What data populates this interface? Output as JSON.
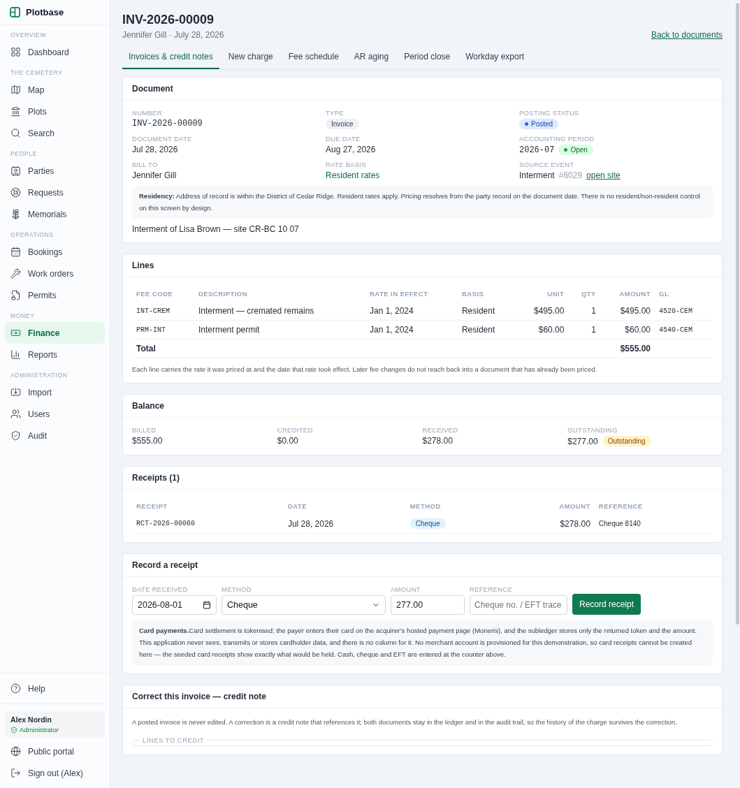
{
  "brand": {
    "name": "Plotbase"
  },
  "sidebar": {
    "sections": [
      {
        "heading": "OVERVIEW",
        "items": [
          {
            "label": "Dashboard",
            "selected": false
          }
        ]
      },
      {
        "heading": "THE CEMETERY",
        "items": [
          {
            "label": "Map",
            "selected": false
          },
          {
            "label": "Plots",
            "selected": false
          },
          {
            "label": "Search",
            "selected": false
          }
        ]
      },
      {
        "heading": "PEOPLE",
        "items": [
          {
            "label": "Parties",
            "selected": false
          },
          {
            "label": "Requests",
            "selected": false
          },
          {
            "label": "Memorials",
            "selected": false
          }
        ]
      },
      {
        "heading": "OPERATIONS",
        "items": [
          {
            "label": "Bookings",
            "selected": false
          },
          {
            "label": "Work orders",
            "selected": false
          },
          {
            "label": "Permits",
            "selected": false
          }
        ]
      },
      {
        "heading": "MONEY",
        "items": [
          {
            "label": "Finance",
            "selected": true
          },
          {
            "label": "Reports",
            "selected": false
          }
        ]
      },
      {
        "heading": "ADMINISTRATION",
        "items": [
          {
            "label": "Import",
            "selected": false
          },
          {
            "label": "Users",
            "selected": false
          },
          {
            "label": "Audit",
            "selected": false
          }
        ]
      }
    ],
    "help": "Help",
    "user": {
      "name": "Alex Nordin",
      "role": "Administrator"
    },
    "links": [
      "Public portal",
      "Sign out (Alex)"
    ]
  },
  "header": {
    "title": "INV-2026-00009",
    "subtitle": "Jennifer Gill · July 28, 2026",
    "back_link": "Back to documents"
  },
  "tabs": [
    {
      "label": "Invoices & credit notes",
      "selected": true
    },
    {
      "label": "New charge",
      "selected": false
    },
    {
      "label": "Fee schedule",
      "selected": false
    },
    {
      "label": "AR aging",
      "selected": false
    },
    {
      "label": "Period close",
      "selected": false
    },
    {
      "label": "Workday export",
      "selected": false
    }
  ],
  "document": {
    "title": "Document",
    "fields": [
      {
        "kind": "mono",
        "label": "NUMBER",
        "value": "INV-2026-00009"
      },
      {
        "kind": "pill",
        "label": "TYPE",
        "value": "Invoice"
      },
      {
        "kind": "status",
        "label": "POSTING STATUS",
        "value": "Posted",
        "color": "#2563eb"
      },
      {
        "kind": "text",
        "label": "DOCUMENT DATE",
        "value": "Jul 28, 2026"
      },
      {
        "kind": "text",
        "label": "DUE DATE",
        "value": "Aug 27, 2026"
      },
      {
        "kind": "period",
        "label": "ACCOUNTING PERIOD",
        "value": "2026-07",
        "badge": "Open",
        "color": "#16a34a"
      },
      {
        "kind": "text",
        "label": "BILL TO",
        "value": "Jennifer Gill"
      },
      {
        "kind": "accent",
        "label": "RATE BASIS",
        "value": "Resident rates"
      },
      {
        "kind": "source",
        "label": "SOURCE EVENT",
        "value": "Interment",
        "ref": "#6029",
        "link": "open site"
      }
    ],
    "note": "**Residency:** Address of record is within the District of Cedar Ridge. Resident rates apply. Pricing resolves from the party record on the document date. There is no resident/non-resident control on this screen by design.",
    "description": "Interment of Lisa Brown — site CR-BC 10 07"
  },
  "lines": {
    "title": "Lines",
    "columns": [
      "FEE CODE",
      "DESCRIPTION",
      "RATE IN EFFECT",
      "BASIS",
      "UNIT",
      "QTY",
      "AMOUNT",
      "GL"
    ],
    "rows": [
      [
        "INT-CREM",
        "Interment — cremated remains",
        "Jan 1, 2024",
        "Resident",
        "$495.00",
        "1",
        "$495.00",
        "4520-CEM"
      ],
      [
        "PRM-INT",
        "Interment permit",
        "Jan 1, 2024",
        "Resident",
        "$60.00",
        "1",
        "$60.00",
        "4540-CEM"
      ]
    ],
    "total": {
      "label": "Total",
      "amount": "$555.00"
    },
    "footnote": "Each line carries the rate it was priced at and the date that rate took effect. Later fee changes do not reach back into a document that has already been priced."
  },
  "balance": {
    "title": "Balance",
    "items": [
      {
        "label": "BILLED",
        "value": "$555.00"
      },
      {
        "label": "CREDITED",
        "value": "$0.00"
      },
      {
        "label": "RECEIVED",
        "value": "$278.00"
      },
      {
        "label": "OUTSTANDING",
        "value": "$277.00",
        "badge": "Outstanding"
      }
    ]
  },
  "receipts": {
    "title": "Receipts (1)",
    "columns": [
      "RECEIPT",
      "DATE",
      "METHOD",
      "AMOUNT",
      "REFERENCE"
    ],
    "rows": [
      {
        "receipt": "RCT-2026-00060",
        "date": "Jul 28, 2026",
        "method": "Cheque",
        "amount": "$278.00",
        "reference": "Cheque 8140"
      }
    ]
  },
  "record": {
    "title": "Record a receipt",
    "date": {
      "label": "DATE RECEIVED",
      "value": "2026-08-01"
    },
    "method": {
      "label": "METHOD",
      "value": "Cheque"
    },
    "amount": {
      "label": "AMOUNT",
      "value": "277.00"
    },
    "reference": {
      "label": "REFERENCE",
      "placeholder": "Cheque no. / EFT trace"
    },
    "button": "Record receipt",
    "note": "**Card payments.**Card settlement is tokenised: the payer enters their card on the acquirer’s hosted payment page (Moneris), and the subledger stores only the returned token and the amount. This application never sees, transmits or stores cardholder data, and there is no column for it. No merchant account is provisioned for this demonstration, so card receipts cannot be created here — the seeded card receipts show exactly what would be held. Cash, cheque and EFT are entered at the counter above."
  },
  "credit": {
    "title": "Correct this invoice — credit note",
    "text": "A posted invoice is never edited. A correction is a credit note that references it; both documents stay in the ledger and in the audit trail, so the history of the charge survives the correction.",
    "legend": "LINES TO CREDIT"
  }
}
